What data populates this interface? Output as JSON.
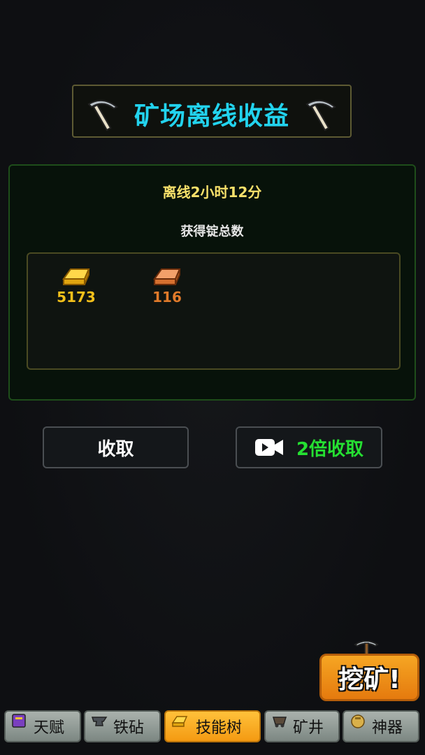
{
  "title": "矿场离线收益",
  "offline": {
    "time_text": "离线2小时12分",
    "total_label": "获得锭总数"
  },
  "rewards": [
    {
      "type": "gold-ingot",
      "amount": "5173",
      "color": "#f3c01a"
    },
    {
      "type": "copper-ingot",
      "amount": "116",
      "color": "#e07a2a"
    }
  ],
  "buttons": {
    "collect": "收取",
    "double_collect": "2倍收取"
  },
  "dig_button": "挖矿!",
  "nav": [
    {
      "label": "天赋",
      "icon": "book-icon",
      "active": false
    },
    {
      "label": "铁砧",
      "icon": "anvil-icon",
      "active": false
    },
    {
      "label": "技能树",
      "icon": "ingot-icon",
      "active": true
    },
    {
      "label": "矿井",
      "icon": "mine-cart-icon",
      "active": false
    },
    {
      "label": "神器",
      "icon": "artifact-icon",
      "active": false
    }
  ],
  "colors": {
    "title": "#22d3ee",
    "time": "#f7e06a",
    "double_collect": "#25e032",
    "active_tab": "#f49a12"
  }
}
